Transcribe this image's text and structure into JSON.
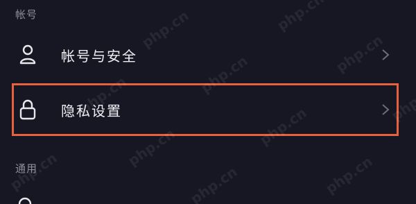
{
  "sections": {
    "account": {
      "title": "帐号"
    },
    "general": {
      "title": "通用"
    }
  },
  "items": [
    {
      "label": "帐号与安全",
      "icon": "user-icon"
    },
    {
      "label": "隐私设置",
      "icon": "lock-icon"
    }
  ],
  "watermark": "php.cn",
  "colors": {
    "background": "#161723",
    "highlight": "#e8613c",
    "text": "#f0f0f4",
    "section_text": "#8d8e99",
    "chevron": "#6d6e78"
  }
}
